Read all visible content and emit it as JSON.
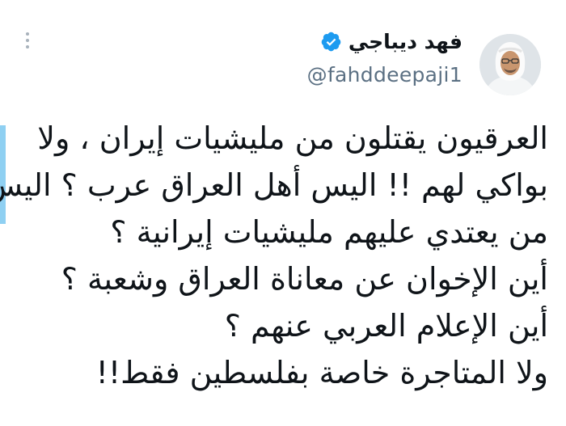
{
  "tweet": {
    "author": {
      "display_name": "فهد ديباجي",
      "handle": "@fahddeepaji1",
      "verified": true,
      "avatar_icon": "user-avatar"
    },
    "menu_icon": "more-vertical-icon",
    "text_lines": [
      "العرقيون يقتلون من مليشيات إيران ، ولا",
      "بواكي لهم !! اليس أهل العراق عرب ؟ اليس",
      "من يعتدي عليهم مليشيات إيرانية  ؟",
      "أين الإخوان عن معاناة العراق وشعبة ؟",
      "أين الإعلام العربي عنهم ؟",
      "ولا المتاجرة خاصة بفلسطين فقط!!"
    ]
  },
  "colors": {
    "text": "#0f1419",
    "handle": "#5b7083",
    "verified_badge": "#1d9bf0",
    "accent_edge": "#8fd0f2"
  }
}
